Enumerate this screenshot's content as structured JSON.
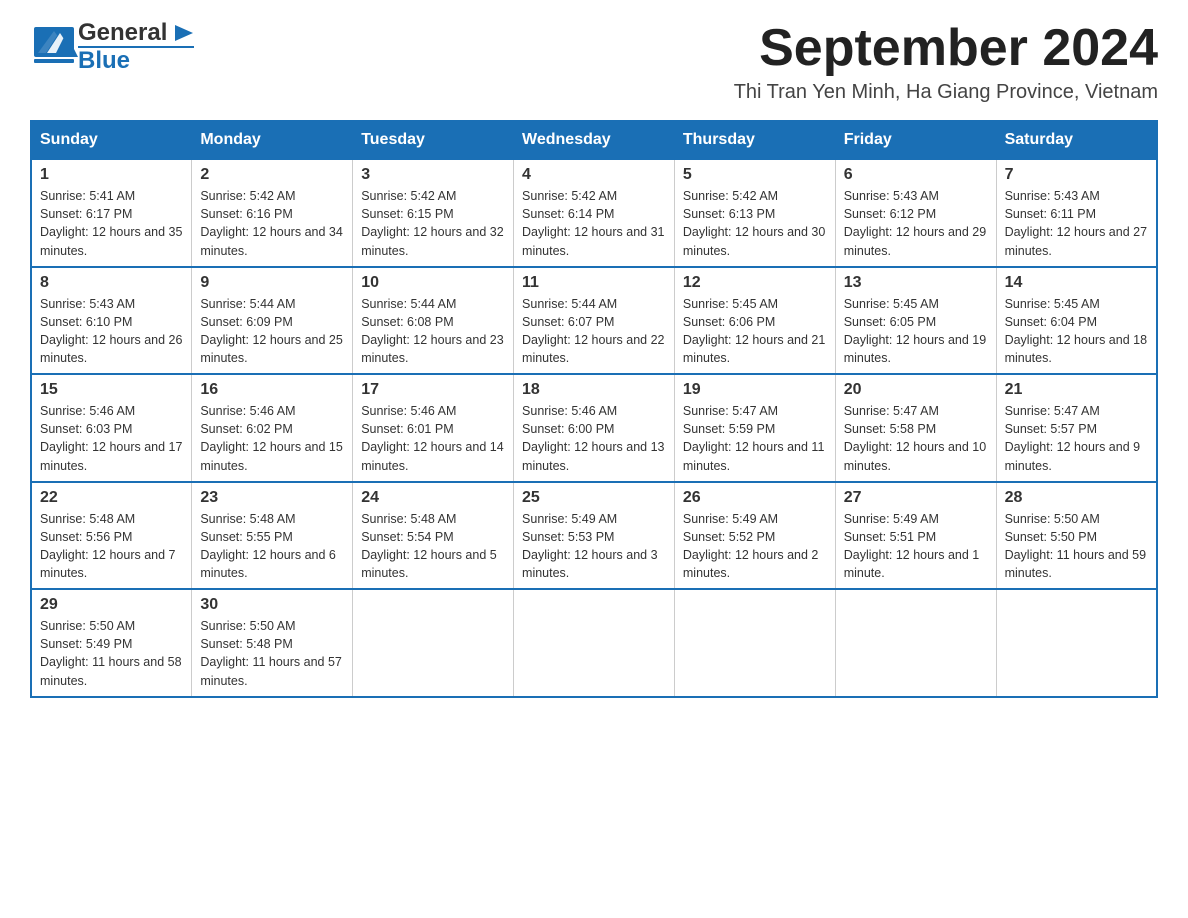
{
  "header": {
    "logo_general": "General",
    "logo_blue": "Blue",
    "month_title": "September 2024",
    "location": "Thi Tran Yen Minh, Ha Giang Province, Vietnam"
  },
  "days_of_week": [
    "Sunday",
    "Monday",
    "Tuesday",
    "Wednesday",
    "Thursday",
    "Friday",
    "Saturday"
  ],
  "weeks": [
    [
      {
        "day": "1",
        "sunrise": "Sunrise: 5:41 AM",
        "sunset": "Sunset: 6:17 PM",
        "daylight": "Daylight: 12 hours and 35 minutes."
      },
      {
        "day": "2",
        "sunrise": "Sunrise: 5:42 AM",
        "sunset": "Sunset: 6:16 PM",
        "daylight": "Daylight: 12 hours and 34 minutes."
      },
      {
        "day": "3",
        "sunrise": "Sunrise: 5:42 AM",
        "sunset": "Sunset: 6:15 PM",
        "daylight": "Daylight: 12 hours and 32 minutes."
      },
      {
        "day": "4",
        "sunrise": "Sunrise: 5:42 AM",
        "sunset": "Sunset: 6:14 PM",
        "daylight": "Daylight: 12 hours and 31 minutes."
      },
      {
        "day": "5",
        "sunrise": "Sunrise: 5:42 AM",
        "sunset": "Sunset: 6:13 PM",
        "daylight": "Daylight: 12 hours and 30 minutes."
      },
      {
        "day": "6",
        "sunrise": "Sunrise: 5:43 AM",
        "sunset": "Sunset: 6:12 PM",
        "daylight": "Daylight: 12 hours and 29 minutes."
      },
      {
        "day": "7",
        "sunrise": "Sunrise: 5:43 AM",
        "sunset": "Sunset: 6:11 PM",
        "daylight": "Daylight: 12 hours and 27 minutes."
      }
    ],
    [
      {
        "day": "8",
        "sunrise": "Sunrise: 5:43 AM",
        "sunset": "Sunset: 6:10 PM",
        "daylight": "Daylight: 12 hours and 26 minutes."
      },
      {
        "day": "9",
        "sunrise": "Sunrise: 5:44 AM",
        "sunset": "Sunset: 6:09 PM",
        "daylight": "Daylight: 12 hours and 25 minutes."
      },
      {
        "day": "10",
        "sunrise": "Sunrise: 5:44 AM",
        "sunset": "Sunset: 6:08 PM",
        "daylight": "Daylight: 12 hours and 23 minutes."
      },
      {
        "day": "11",
        "sunrise": "Sunrise: 5:44 AM",
        "sunset": "Sunset: 6:07 PM",
        "daylight": "Daylight: 12 hours and 22 minutes."
      },
      {
        "day": "12",
        "sunrise": "Sunrise: 5:45 AM",
        "sunset": "Sunset: 6:06 PM",
        "daylight": "Daylight: 12 hours and 21 minutes."
      },
      {
        "day": "13",
        "sunrise": "Sunrise: 5:45 AM",
        "sunset": "Sunset: 6:05 PM",
        "daylight": "Daylight: 12 hours and 19 minutes."
      },
      {
        "day": "14",
        "sunrise": "Sunrise: 5:45 AM",
        "sunset": "Sunset: 6:04 PM",
        "daylight": "Daylight: 12 hours and 18 minutes."
      }
    ],
    [
      {
        "day": "15",
        "sunrise": "Sunrise: 5:46 AM",
        "sunset": "Sunset: 6:03 PM",
        "daylight": "Daylight: 12 hours and 17 minutes."
      },
      {
        "day": "16",
        "sunrise": "Sunrise: 5:46 AM",
        "sunset": "Sunset: 6:02 PM",
        "daylight": "Daylight: 12 hours and 15 minutes."
      },
      {
        "day": "17",
        "sunrise": "Sunrise: 5:46 AM",
        "sunset": "Sunset: 6:01 PM",
        "daylight": "Daylight: 12 hours and 14 minutes."
      },
      {
        "day": "18",
        "sunrise": "Sunrise: 5:46 AM",
        "sunset": "Sunset: 6:00 PM",
        "daylight": "Daylight: 12 hours and 13 minutes."
      },
      {
        "day": "19",
        "sunrise": "Sunrise: 5:47 AM",
        "sunset": "Sunset: 5:59 PM",
        "daylight": "Daylight: 12 hours and 11 minutes."
      },
      {
        "day": "20",
        "sunrise": "Sunrise: 5:47 AM",
        "sunset": "Sunset: 5:58 PM",
        "daylight": "Daylight: 12 hours and 10 minutes."
      },
      {
        "day": "21",
        "sunrise": "Sunrise: 5:47 AM",
        "sunset": "Sunset: 5:57 PM",
        "daylight": "Daylight: 12 hours and 9 minutes."
      }
    ],
    [
      {
        "day": "22",
        "sunrise": "Sunrise: 5:48 AM",
        "sunset": "Sunset: 5:56 PM",
        "daylight": "Daylight: 12 hours and 7 minutes."
      },
      {
        "day": "23",
        "sunrise": "Sunrise: 5:48 AM",
        "sunset": "Sunset: 5:55 PM",
        "daylight": "Daylight: 12 hours and 6 minutes."
      },
      {
        "day": "24",
        "sunrise": "Sunrise: 5:48 AM",
        "sunset": "Sunset: 5:54 PM",
        "daylight": "Daylight: 12 hours and 5 minutes."
      },
      {
        "day": "25",
        "sunrise": "Sunrise: 5:49 AM",
        "sunset": "Sunset: 5:53 PM",
        "daylight": "Daylight: 12 hours and 3 minutes."
      },
      {
        "day": "26",
        "sunrise": "Sunrise: 5:49 AM",
        "sunset": "Sunset: 5:52 PM",
        "daylight": "Daylight: 12 hours and 2 minutes."
      },
      {
        "day": "27",
        "sunrise": "Sunrise: 5:49 AM",
        "sunset": "Sunset: 5:51 PM",
        "daylight": "Daylight: 12 hours and 1 minute."
      },
      {
        "day": "28",
        "sunrise": "Sunrise: 5:50 AM",
        "sunset": "Sunset: 5:50 PM",
        "daylight": "Daylight: 11 hours and 59 minutes."
      }
    ],
    [
      {
        "day": "29",
        "sunrise": "Sunrise: 5:50 AM",
        "sunset": "Sunset: 5:49 PM",
        "daylight": "Daylight: 11 hours and 58 minutes."
      },
      {
        "day": "30",
        "sunrise": "Sunrise: 5:50 AM",
        "sunset": "Sunset: 5:48 PM",
        "daylight": "Daylight: 11 hours and 57 minutes."
      },
      {
        "day": "",
        "sunrise": "",
        "sunset": "",
        "daylight": ""
      },
      {
        "day": "",
        "sunrise": "",
        "sunset": "",
        "daylight": ""
      },
      {
        "day": "",
        "sunrise": "",
        "sunset": "",
        "daylight": ""
      },
      {
        "day": "",
        "sunrise": "",
        "sunset": "",
        "daylight": ""
      },
      {
        "day": "",
        "sunrise": "",
        "sunset": "",
        "daylight": ""
      }
    ]
  ]
}
